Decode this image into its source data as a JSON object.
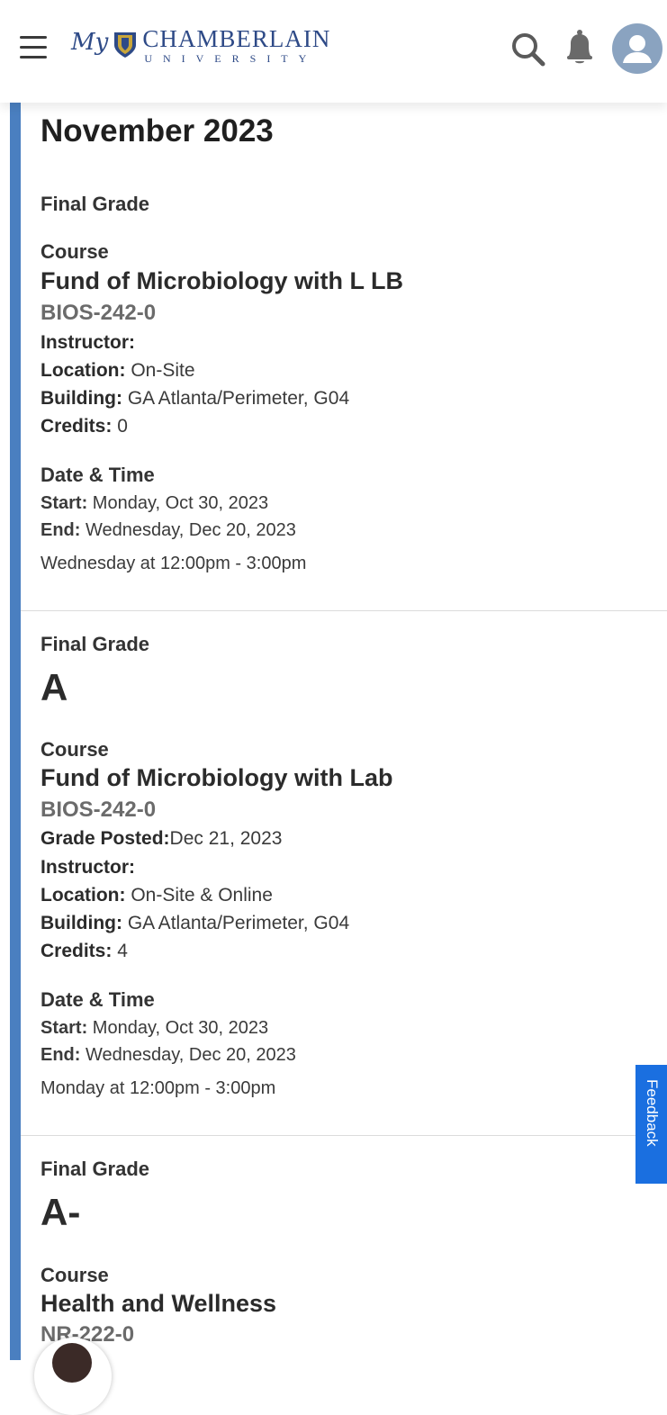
{
  "header": {
    "logo_my": "My",
    "logo_name": "CHAMBERLAIN",
    "logo_sub": "UNIVERSITY",
    "icons": [
      "menu-icon",
      "search-icon",
      "bell-icon",
      "user-icon"
    ],
    "brand_color": "#2e4a87",
    "accent_color": "#4a7fc0"
  },
  "month": "November 2023",
  "courses": [
    {
      "final_grade_label": "Final Grade",
      "grade": "",
      "course_label": "Course",
      "title": "Fund of Microbiology with L LB",
      "code": "BIOS-242-0",
      "instructor_label": "Instructor:",
      "location_label": "Location:",
      "location": "On-Site",
      "building_label": "Building:",
      "building": "GA Atlanta/Perimeter, G04",
      "credits_label": "Credits:",
      "credits": "0",
      "datetime_label": "Date & Time",
      "start_label": "Start:",
      "start": "Monday, Oct 30, 2023",
      "end_label": "End:",
      "end": "Wednesday, Dec 20, 2023",
      "schedule": "Wednesday at 12:00pm - 3:00pm"
    },
    {
      "final_grade_label": "Final Grade",
      "grade": "A",
      "course_label": "Course",
      "title": "Fund of Microbiology with Lab",
      "code": "BIOS-242-0",
      "grade_posted_label": "Grade Posted:",
      "grade_posted": "Dec 21, 2023",
      "instructor_label": "Instructor:",
      "location_label": "Location:",
      "location": "On-Site & Online",
      "building_label": "Building:",
      "building": "GA Atlanta/Perimeter, G04",
      "credits_label": "Credits:",
      "credits": "4",
      "datetime_label": "Date & Time",
      "start_label": "Start:",
      "start": "Monday, Oct 30, 2023",
      "end_label": "End:",
      "end": "Wednesday, Dec 20, 2023",
      "schedule": "Monday at 12:00pm - 3:00pm"
    },
    {
      "final_grade_label": "Final Grade",
      "grade": "A-",
      "course_label": "Course",
      "title": "Health and Wellness",
      "code": "NR-222-0"
    }
  ],
  "feedback": {
    "label": "Feedback",
    "color": "#1a6fe0"
  }
}
